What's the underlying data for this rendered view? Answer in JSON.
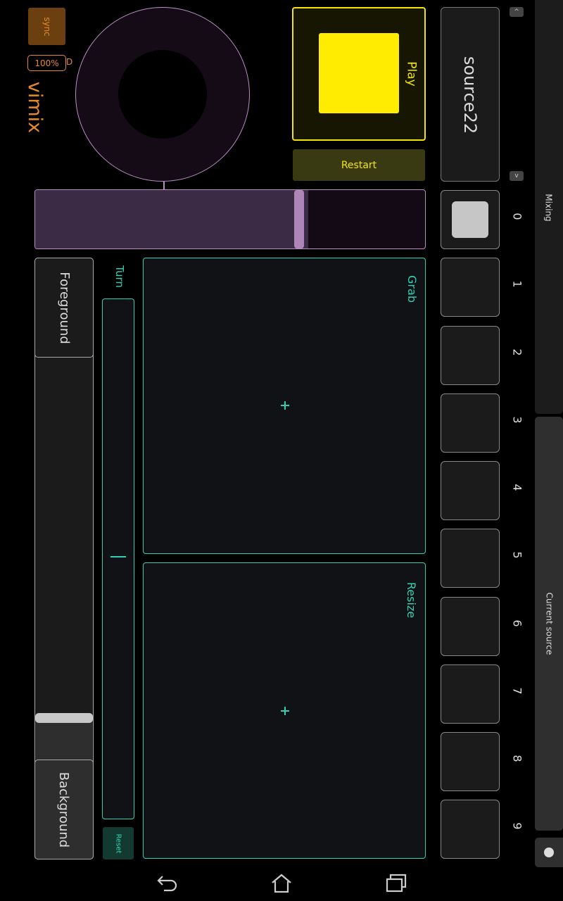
{
  "app": {
    "logo": "vimix"
  },
  "top_left": {
    "sync_label": "sync",
    "percent_value": "100%",
    "percent_suffix": "D"
  },
  "player": {
    "play_label": "Play",
    "restart_label": "Restart",
    "play_color": "#ffec00"
  },
  "mixing": {
    "slider_value": 0.7
  },
  "source": {
    "current": "source22",
    "up_label": "^",
    "down_label": "v"
  },
  "slots": [
    "0",
    "1",
    "2",
    "3",
    "4",
    "5",
    "6",
    "7",
    "8",
    "9"
  ],
  "sidebar": {
    "mixing_label": "Mixing",
    "current_source_label": "Current source"
  },
  "depth": {
    "foreground_label": "Foreground",
    "background_label": "Background"
  },
  "turn": {
    "label": "Turn",
    "reset_label": "Reset"
  },
  "grab": {
    "label": "Grab"
  },
  "resize": {
    "label": "Resize"
  },
  "nav": {
    "icons": [
      "back-icon",
      "home-icon",
      "recent-apps-icon"
    ]
  },
  "colors": {
    "accent_orange": "#e48a2c",
    "accent_teal": "#2fd1b5",
    "accent_purple": "#b78fc0",
    "accent_yellow": "#f2e600"
  }
}
